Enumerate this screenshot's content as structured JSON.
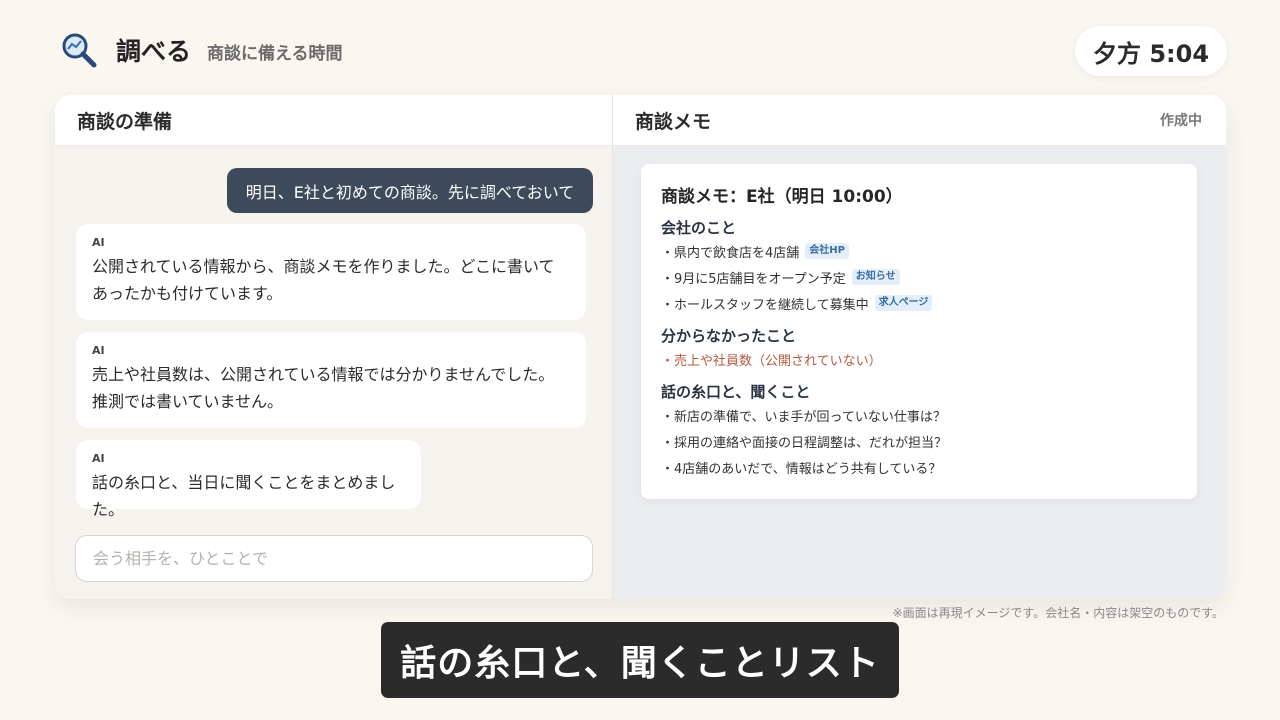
{
  "header": {
    "app_title": "調べる",
    "subtitle": "商談に備える時間",
    "logo_icon": "search-chart-icon"
  },
  "clock": {
    "time": "夕方 5:04"
  },
  "left_pane": {
    "title": "商談の準備",
    "user_message": "明日、E社と初めての商談。先に調べておいて",
    "ai_messages": [
      {
        "label": "AI",
        "text": "公開されている情報から、商談メモを作りました。どこに書いてあったかも付けています。"
      },
      {
        "label": "AI",
        "text": "売上や社員数は、公開されている情報では分かりませんでした。推測では書いていません。"
      },
      {
        "label": "AI",
        "text": "話の糸口と、当日に聞くことをまとめました。"
      }
    ],
    "input_placeholder": "会う相手を、ひとことで"
  },
  "right_pane": {
    "title": "商談メモ",
    "status": "作成中",
    "memo": {
      "title": "商談メモ：E社（明日 10:00）",
      "sections": [
        {
          "heading": "会社のこと",
          "items": [
            {
              "text": "・県内で飲食店を4店舗",
              "source": "会社HP"
            },
            {
              "text": "・9月に5店舗目をオープン予定",
              "source": "お知らせ"
            },
            {
              "text": "・ホールスタッフを継続して募集中",
              "source": "求人ページ"
            }
          ]
        },
        {
          "heading": "分からなかったこと",
          "items": [
            {
              "text": "・売上や社員数（公開されていない）",
              "source": ""
            }
          ]
        },
        {
          "heading": "話の糸口と、聞くこと",
          "items": [
            {
              "text": "・新店の準備で、いま手が回っていない仕事は？",
              "source": ""
            },
            {
              "text": "・採用の連絡や面接の日程調整は、だれが担当？",
              "source": ""
            },
            {
              "text": "・4店舗のあいだで、情報はどう共有している？",
              "source": ""
            }
          ]
        }
      ]
    }
  },
  "disclaimer": "※画面は再現イメージです。会社名・内容は架空のものです。",
  "caption": "話の糸口と、聞くことリスト",
  "colors": {
    "user_bubble": "#3d4a5c",
    "source_tag_bg": "#e3eef8",
    "source_tag_text": "#3a6da3",
    "unknown_text": "#b55a3c",
    "caption_bg": "#2b2b2b"
  }
}
